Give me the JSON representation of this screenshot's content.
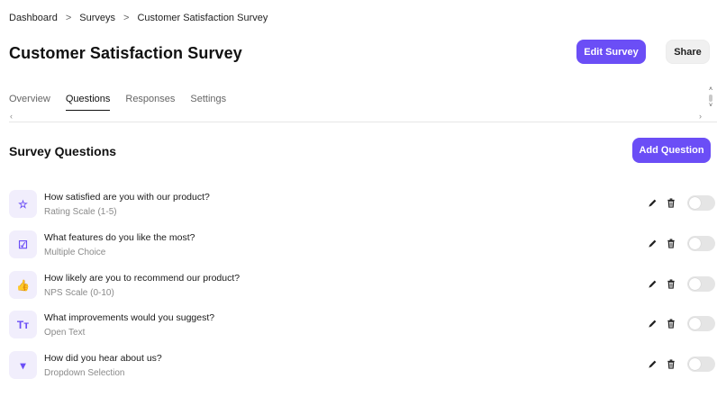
{
  "breadcrumb": [
    "Dashboard",
    "Surveys",
    "Customer Satisfaction Survey"
  ],
  "page_title": "Customer Satisfaction Survey",
  "header_buttons": {
    "edit": "Edit Survey",
    "share": "Share"
  },
  "tabs": [
    {
      "label": "Overview",
      "active": false
    },
    {
      "label": "Questions",
      "active": true
    },
    {
      "label": "Responses",
      "active": false
    },
    {
      "label": "Settings",
      "active": false
    }
  ],
  "section": {
    "title": "Survey Questions",
    "add_button": "Add Question"
  },
  "questions": [
    {
      "icon": "star-icon",
      "glyph": "☆",
      "text": "How satisfied are you with our product?",
      "type": "Rating Scale (1-5)",
      "enabled": false
    },
    {
      "icon": "checkbox-icon",
      "glyph": "☑",
      "text": "What features do you like the most?",
      "type": "Multiple Choice",
      "enabled": false
    },
    {
      "icon": "thumbs-icon",
      "glyph": "👍",
      "text": "How likely are you to recommend our product?",
      "type": "NPS Scale (0-10)",
      "enabled": false
    },
    {
      "icon": "text-icon",
      "glyph": "Tт",
      "text": "What improvements would you suggest?",
      "type": "Open Text",
      "enabled": false
    },
    {
      "icon": "dropdown-icon",
      "glyph": "▾",
      "text": "How did you hear about us?",
      "type": "Dropdown Selection",
      "enabled": false
    }
  ],
  "colors": {
    "accent": "#6b4ef6",
    "icon_bg": "#f1eefc",
    "toggle_off": "#e5e5e5"
  }
}
